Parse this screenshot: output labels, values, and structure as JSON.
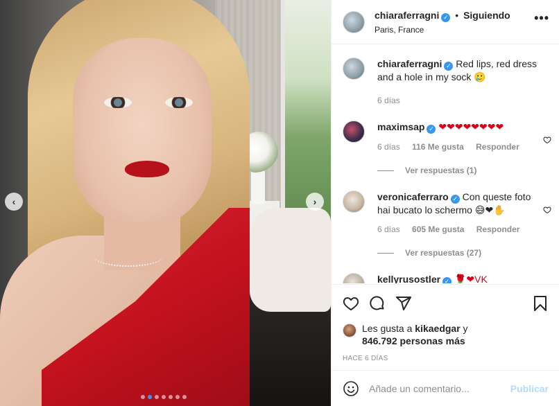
{
  "post": {
    "username": "chiaraferragni",
    "follow_status": "Siguiendo",
    "separator": "•",
    "location": "Paris, France",
    "more_label": "•••"
  },
  "caption": {
    "username": "chiaraferragni",
    "text": "Red lips, red dress and a hole in my sock 🥲",
    "age": "6 días"
  },
  "comments": [
    {
      "username": "maximsap",
      "text": "❤❤❤❤❤❤❤❤",
      "age": "6 días",
      "likes": "116 Me gusta",
      "reply": "Responder",
      "view_replies": "Ver respuestas (1)"
    },
    {
      "username": "veronicaferraro",
      "text": "Con queste foto hai bucato lo schermo 😅❤✋",
      "age": "6 días",
      "likes": "605 Me gusta",
      "reply": "Responder",
      "view_replies": "Ver respuestas (27)"
    },
    {
      "username": "kellyrusostler",
      "text": "🌹❤VK",
      "age": "",
      "likes": "",
      "reply": "",
      "view_replies": ""
    }
  ],
  "likes": {
    "prefix": "Les gusta a ",
    "user": "kikaedgar",
    "mid": " y",
    "count": "846.792 personas más"
  },
  "time_ago": "HACE 6 DÍAS",
  "add_comment": {
    "placeholder": "Añade un comentario...",
    "publish": "Publicar"
  },
  "carousel": {
    "prev": "‹",
    "next": "›",
    "dot_count": 7,
    "active_index": 1
  },
  "colors": {
    "verified": "#3897f0",
    "carousel_active": "#3d9ae8",
    "publish_disabled": "#b3dbff",
    "hearts": "#d9001b"
  },
  "icons": [
    "heart-icon",
    "comment-icon",
    "share-icon",
    "bookmark-icon",
    "emoji-icon",
    "verified-icon",
    "more-icon"
  ]
}
